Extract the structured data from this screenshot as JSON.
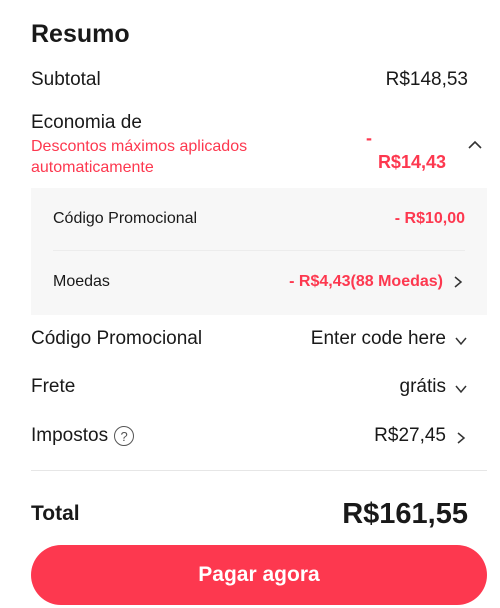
{
  "summary": {
    "title": "Resumo",
    "subtotal": {
      "label": "Subtotal",
      "value": "R$148,53"
    },
    "savings": {
      "label": "Economia de",
      "note": "Descontos máximos aplicados automaticamente",
      "value_dash": "-",
      "value_amount": "R$14,43",
      "icon": "chevron-up-icon",
      "items": [
        {
          "label": "Código Promocional",
          "value": "- R$10,00"
        },
        {
          "label": "Moedas",
          "value": "- R$4,43(88 Moedas)",
          "icon": "chevron-right-icon"
        }
      ]
    },
    "promo": {
      "label": "Código Promocional",
      "value": "Enter code here",
      "icon": "chevron-down-icon"
    },
    "shipping": {
      "label": "Frete",
      "value": "grátis",
      "icon": "chevron-down-icon"
    },
    "taxes": {
      "label": "Impostos",
      "help_glyph": "?",
      "value": "R$27,45",
      "icon": "chevron-right-icon"
    },
    "total": {
      "label": "Total",
      "value": "R$161,55"
    },
    "pay_button": "Pagar agora"
  },
  "colors": {
    "accent": "#fd384f",
    "text": "#191919",
    "panel_bg": "#f7f7f7"
  }
}
